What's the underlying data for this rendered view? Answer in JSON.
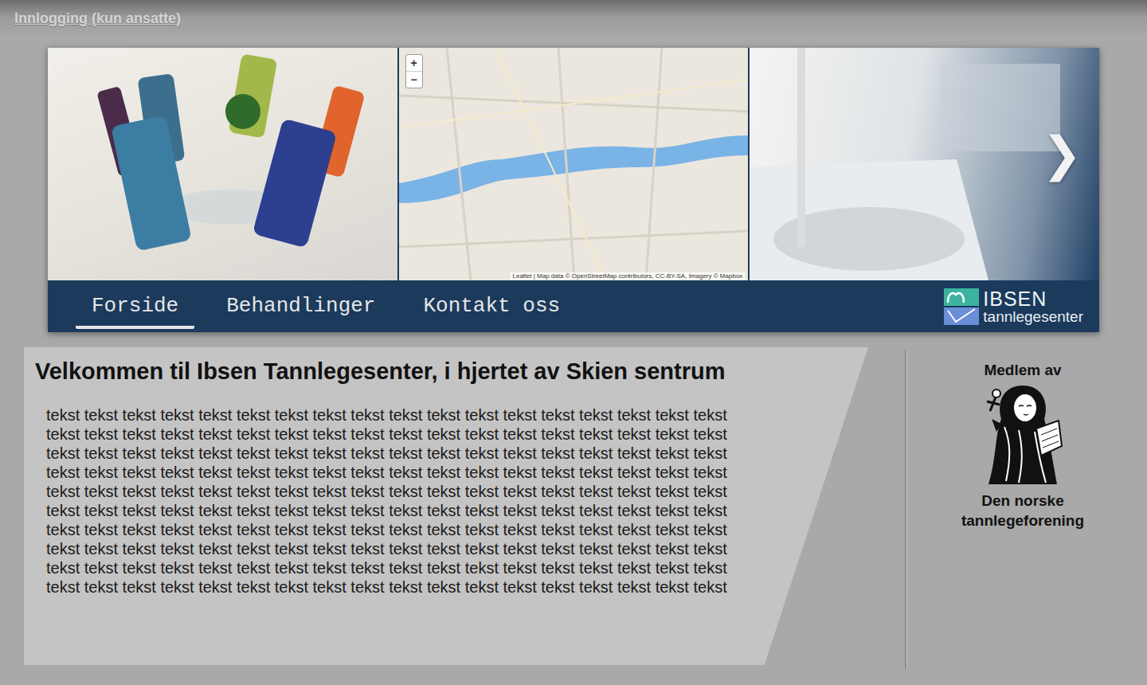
{
  "header": {
    "login_link": "Innlogging (kun ansatte)"
  },
  "carousel": {
    "next": "❯",
    "map": {
      "zoom_in": "+",
      "zoom_out": "−",
      "attribution": "Leaflet | Map data © OpenStreetMap contributors, CC-BY-SA, Imagery © Mapbox"
    }
  },
  "nav": {
    "items": [
      {
        "label": "Forside",
        "selected": true
      },
      {
        "label": "Behandlinger",
        "selected": false
      },
      {
        "label": "Kontakt oss",
        "selected": false
      }
    ],
    "logo": {
      "name": "IBSEN",
      "subtitle": "tannlegesenter"
    }
  },
  "main": {
    "heading": "Velkommen til Ibsen Tannlegesenter, i hjertet av Skien sentrum",
    "paragraph_lines": [
      "tekst tekst tekst tekst tekst tekst tekst tekst tekst tekst tekst tekst tekst tekst tekst tekst tekst tekst",
      "tekst tekst tekst tekst tekst tekst tekst tekst tekst tekst tekst tekst tekst tekst tekst tekst tekst tekst",
      "tekst tekst tekst tekst tekst tekst tekst tekst tekst tekst tekst tekst tekst tekst tekst tekst tekst tekst",
      "tekst tekst tekst tekst tekst tekst tekst tekst tekst tekst tekst tekst tekst tekst tekst tekst tekst tekst",
      "tekst tekst tekst tekst tekst tekst tekst tekst tekst tekst tekst tekst tekst tekst tekst tekst tekst tekst",
      "tekst tekst tekst tekst tekst tekst tekst tekst tekst tekst tekst tekst tekst tekst tekst tekst tekst tekst",
      "tekst tekst tekst tekst tekst tekst tekst tekst tekst tekst tekst tekst tekst tekst tekst tekst tekst tekst",
      "tekst tekst tekst tekst tekst tekst tekst tekst tekst tekst tekst tekst tekst tekst tekst tekst tekst tekst",
      "tekst tekst tekst tekst tekst tekst tekst tekst tekst tekst tekst tekst tekst tekst tekst tekst tekst tekst",
      "tekst tekst tekst tekst tekst tekst tekst tekst tekst tekst tekst tekst tekst tekst tekst tekst tekst tekst"
    ]
  },
  "sidebar": {
    "label": "Medlem av",
    "organization": "Den norske tannlegeforening"
  }
}
